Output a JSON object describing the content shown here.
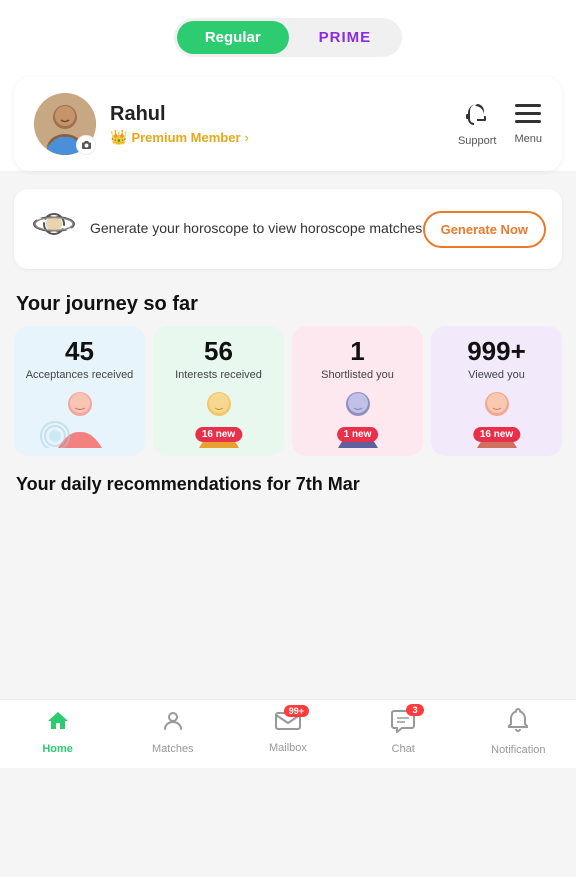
{
  "toggle": {
    "regular_label": "Regular",
    "prime_label": "PRIME"
  },
  "profile": {
    "name": "Rahul",
    "premium_text": "Premium Member",
    "support_label": "Support",
    "menu_label": "Menu"
  },
  "horoscope": {
    "text": "Generate your horoscope to view horoscope matches",
    "button_label": "Generate Now"
  },
  "journey": {
    "title": "Your journey so far",
    "stats": [
      {
        "number": "45",
        "label": "Acceptances received",
        "color": "blue",
        "new_badge": null
      },
      {
        "number": "56",
        "label": "Interests received",
        "color": "green",
        "new_badge": "16 new"
      },
      {
        "number": "1",
        "label": "Shortlisted you",
        "color": "pink",
        "new_badge": "1 new"
      },
      {
        "number": "999+",
        "label": "Viewed you",
        "color": "purple",
        "new_badge": "16 new"
      }
    ]
  },
  "recommendations": {
    "title": "Your daily recommendations for 7th Mar"
  },
  "bottom_nav": [
    {
      "id": "home",
      "label": "Home",
      "icon": "🏠",
      "active": true,
      "badge": null
    },
    {
      "id": "matches",
      "label": "Matches",
      "icon": "👤",
      "active": false,
      "badge": null
    },
    {
      "id": "mailbox",
      "label": "Mailbox",
      "icon": "✉️",
      "active": false,
      "badge": "99+"
    },
    {
      "id": "chat",
      "label": "Chat",
      "icon": "💬",
      "active": false,
      "badge": "3"
    },
    {
      "id": "notification",
      "label": "Notification",
      "icon": "🔔",
      "active": false,
      "badge": null
    }
  ]
}
